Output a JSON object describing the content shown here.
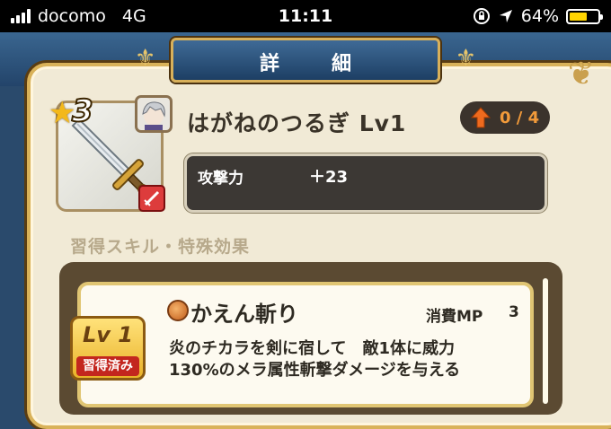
{
  "status_bar": {
    "carrier": "docomo",
    "network": "4G",
    "time": "11:11",
    "battery_percent": "64%",
    "battery_level": 0.64,
    "battery_color": "#ffd400"
  },
  "header": {
    "title": "詳　細"
  },
  "item": {
    "star_icon": "star-icon",
    "rarity": "3",
    "name": "はがねのつるぎ Lv1",
    "upgrade": "0 / 4",
    "stats": [
      {
        "label": "攻撃力",
        "value": "＋23"
      }
    ]
  },
  "skills": {
    "section_label": "習得スキル・特殊効果",
    "entries": [
      {
        "level": "Lv 1",
        "status": "習得済み",
        "name": "かえん斬り",
        "mp_label": "消費MP",
        "mp_value": "3",
        "desc_line1": "炎のチカラを剣に宿して　敵1体に威力",
        "desc_line2": "130%のメラ属性斬撃ダメージを与える"
      }
    ]
  },
  "colors": {
    "accent_gold": "#d9b259",
    "panel_bg": "#f1ead6",
    "upgrade_text": "#f19a3a",
    "lv_badge_red": "#c3261e"
  }
}
